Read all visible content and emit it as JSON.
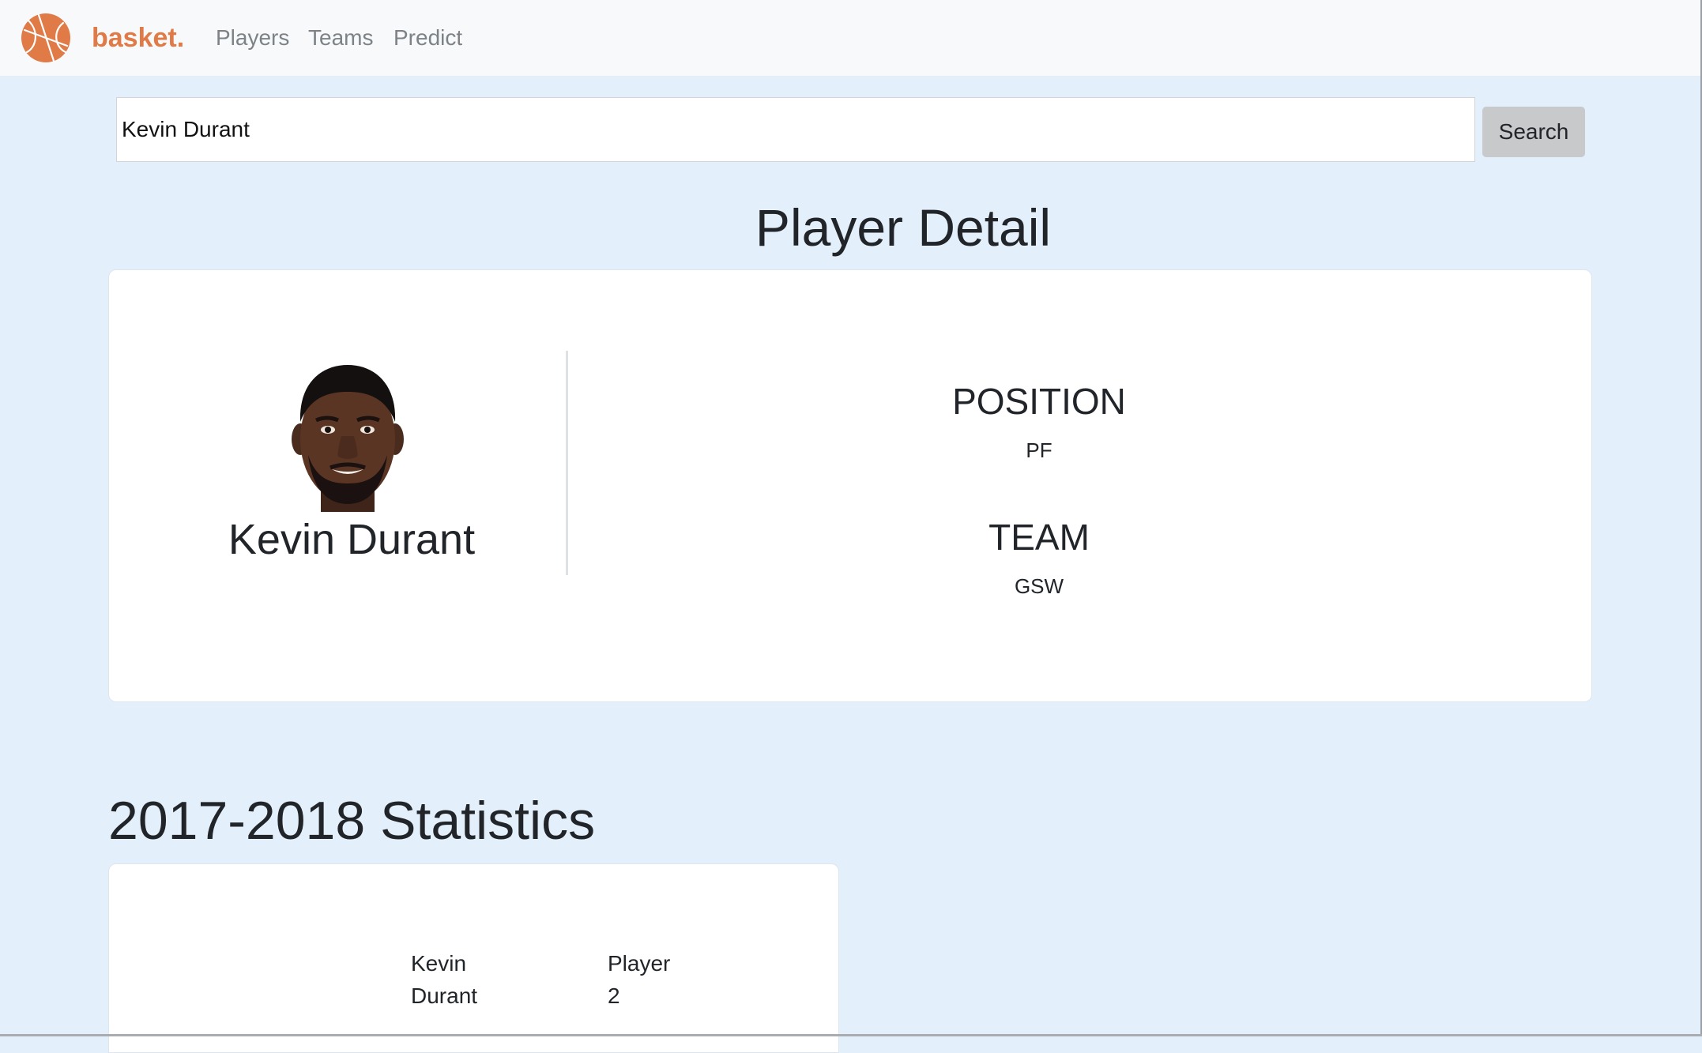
{
  "navbar": {
    "brand": "basket.",
    "links": [
      "Players",
      "Teams",
      "Predict"
    ]
  },
  "search": {
    "value": "Kevin Durant",
    "button_label": "Search"
  },
  "page": {
    "title": "Player Detail"
  },
  "player": {
    "name": "Kevin Durant",
    "position_label": "POSITION",
    "position": "PF",
    "team_label": "TEAM",
    "team": "GSW"
  },
  "stats": {
    "title": "2017-2018 Statistics",
    "cells": [
      [
        "Kevin",
        "Durant"
      ],
      [
        "Player",
        "2"
      ]
    ]
  },
  "colors": {
    "brand": "#e07a46",
    "background": "#e3effa",
    "nav_link": "#7d8287"
  },
  "icons": {
    "logo": "basketball-icon"
  }
}
